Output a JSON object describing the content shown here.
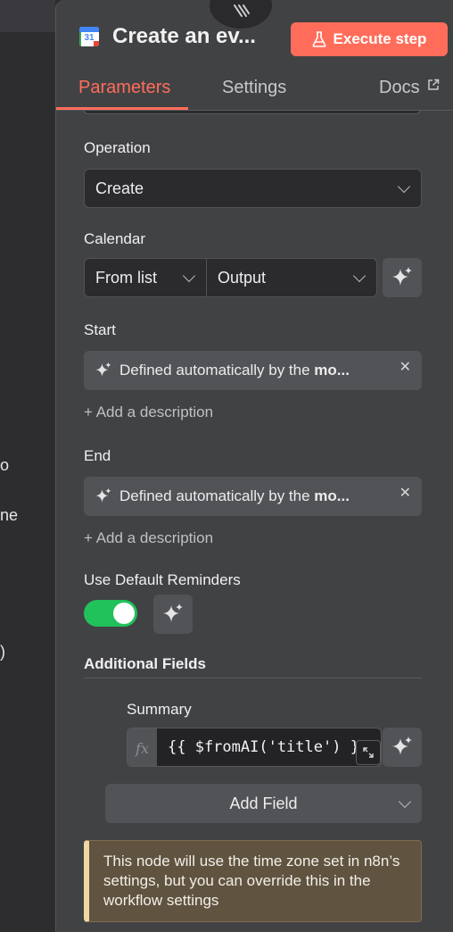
{
  "background": {
    "fragments": [
      "o",
      "ne",
      ")"
    ]
  },
  "header": {
    "title": "Create an ev...",
    "app_icon_day": "31",
    "execute_label": "Execute step"
  },
  "tabs": [
    {
      "label": "Parameters",
      "active": true
    },
    {
      "label": "Settings",
      "active": false
    },
    {
      "label": "Docs",
      "active": false
    }
  ],
  "fields": {
    "operation": {
      "label": "Operation",
      "value": "Create"
    },
    "calendar": {
      "label": "Calendar",
      "mode": "From list",
      "value": "Output"
    },
    "start": {
      "label": "Start",
      "text": "Defined automatically by the ",
      "bold": "mo..."
    },
    "end": {
      "label": "End",
      "text": "Defined automatically by the ",
      "bold": "mo..."
    },
    "add_description": "+ Add a description",
    "reminders": {
      "label": "Use Default Reminders",
      "on": true
    },
    "additional": {
      "label": "Additional Fields",
      "summary_label": "Summary",
      "fx": "fx",
      "expression": "{{ $fromAI('title') }}",
      "add_field": "Add Field"
    }
  },
  "notice": "This node will use the time zone set in n8n’s settings, but you can override this in the workflow settings",
  "colors": {
    "accent": "#ff6d5a",
    "toggle_on": "#21c15b",
    "panel": "#414244",
    "notice_bg": "#605340"
  }
}
